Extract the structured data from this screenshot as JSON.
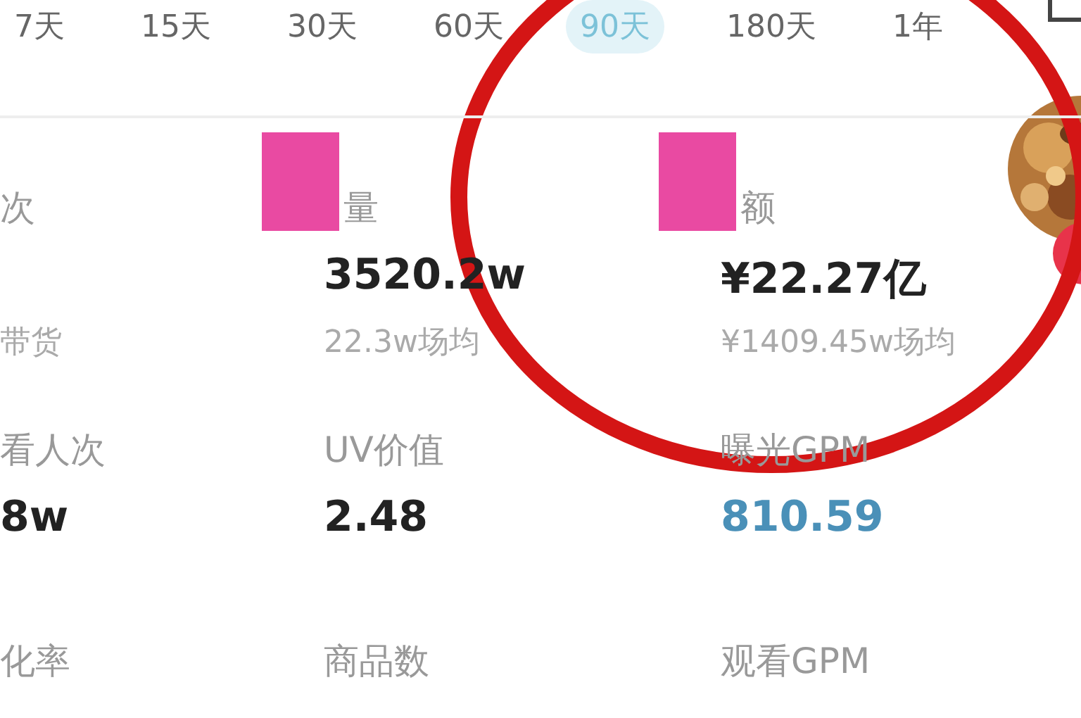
{
  "tabs": [
    {
      "label": "7天",
      "selected": false
    },
    {
      "label": "15天",
      "selected": false
    },
    {
      "label": "30天",
      "selected": false
    },
    {
      "label": "60天",
      "selected": false
    },
    {
      "label": "90天",
      "selected": true
    },
    {
      "label": "180天",
      "selected": false
    },
    {
      "label": "1年",
      "selected": false
    }
  ],
  "metrics": [
    {
      "label": "次",
      "sub": "带货"
    },
    {
      "label": "量",
      "redacted": true,
      "value": "3520.2w",
      "sub": "22.3w场均"
    },
    {
      "label": "额",
      "redacted": true,
      "value": "¥22.27亿",
      "sub": "¥1409.45w场均"
    },
    {
      "label": "看人次",
      "value": "8w"
    },
    {
      "label": "UV价值",
      "value": "2.48"
    },
    {
      "label": "曝光GPM",
      "value": "810.59",
      "highlighted": true
    },
    {
      "label": "化率"
    },
    {
      "label": "商品数"
    },
    {
      "label": "观看GPM"
    }
  ]
}
